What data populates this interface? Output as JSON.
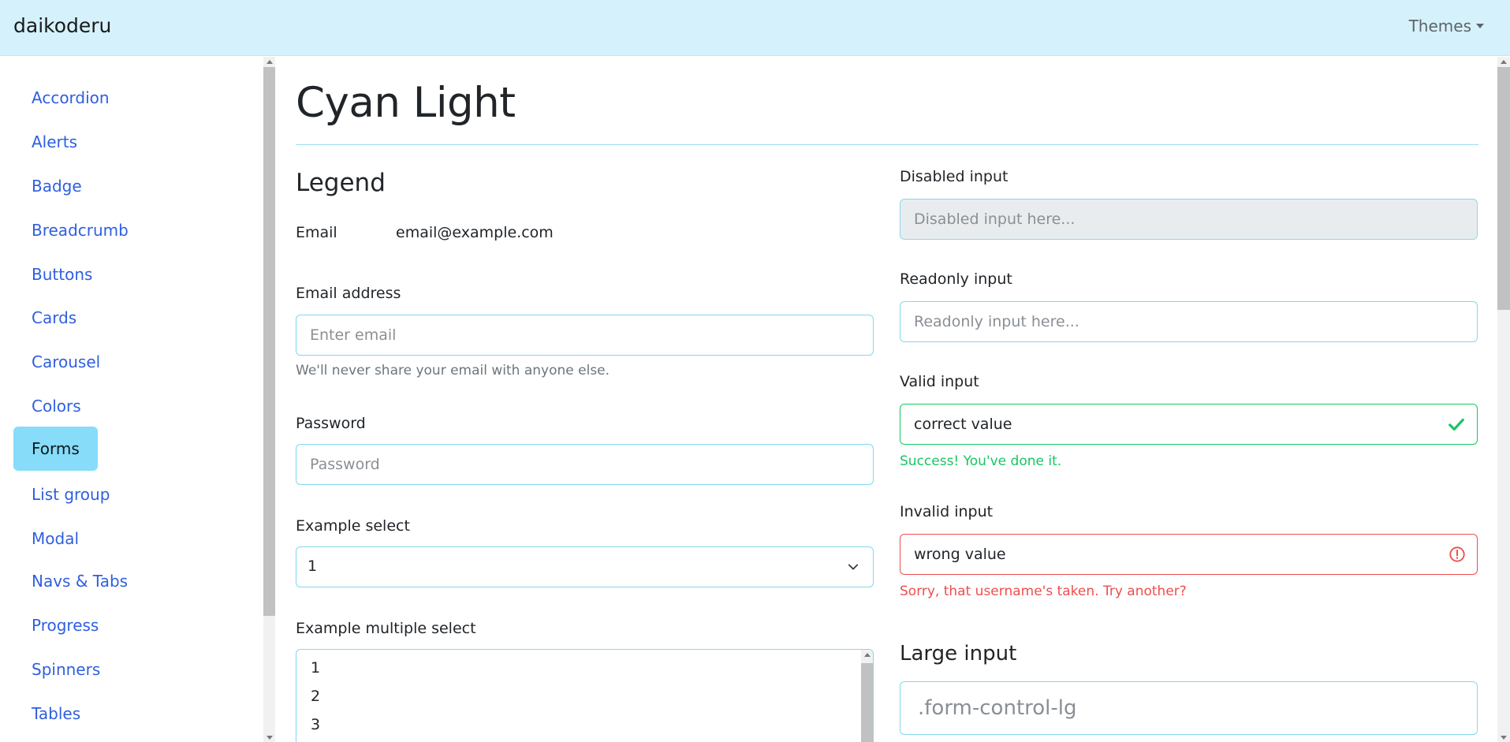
{
  "navbar": {
    "brand": "daikoderu",
    "themes_label": "Themes"
  },
  "sidebar": {
    "items": [
      {
        "label": "Accordion",
        "active": false
      },
      {
        "label": "Alerts",
        "active": false
      },
      {
        "label": "Badge",
        "active": false
      },
      {
        "label": "Breadcrumb",
        "active": false
      },
      {
        "label": "Buttons",
        "active": false
      },
      {
        "label": "Cards",
        "active": false
      },
      {
        "label": "Carousel",
        "active": false
      },
      {
        "label": "Colors",
        "active": false
      },
      {
        "label": "Forms",
        "active": true
      },
      {
        "label": "List group",
        "active": false
      },
      {
        "label": "Modal",
        "active": false
      },
      {
        "label": "Navs & Tabs",
        "active": false
      },
      {
        "label": "Progress",
        "active": false
      },
      {
        "label": "Spinners",
        "active": false
      },
      {
        "label": "Tables",
        "active": false
      }
    ]
  },
  "main": {
    "title": "Cyan Light",
    "left": {
      "legend": "Legend",
      "email_static": {
        "label": "Email",
        "value": "email@example.com"
      },
      "email_address": {
        "label": "Email address",
        "placeholder": "Enter email",
        "value": "",
        "help": "We'll never share your email with anyone else."
      },
      "password": {
        "label": "Password",
        "placeholder": "Password",
        "value": ""
      },
      "example_select": {
        "label": "Example select",
        "selected": "1"
      },
      "multiple_select": {
        "label": "Example multiple select",
        "options": [
          "1",
          "2",
          "3"
        ]
      }
    },
    "right": {
      "disabled": {
        "label": "Disabled input",
        "placeholder": "Disabled input here..."
      },
      "readonly": {
        "label": "Readonly input",
        "placeholder": "Readonly input here..."
      },
      "valid": {
        "label": "Valid input",
        "value": "correct value",
        "feedback": "Success! You've done it."
      },
      "invalid": {
        "label": "Invalid input",
        "value": "wrong value",
        "feedback": "Sorry, that username's taken. Try another?"
      },
      "large": {
        "heading": "Large input",
        "placeholder": ".form-control-lg"
      }
    }
  },
  "colors": {
    "accent": "#86dcf9",
    "navbar_bg": "#d5f2fc",
    "link": "#2f5fe0",
    "valid": "#19c562",
    "invalid": "#ef4d4d"
  }
}
